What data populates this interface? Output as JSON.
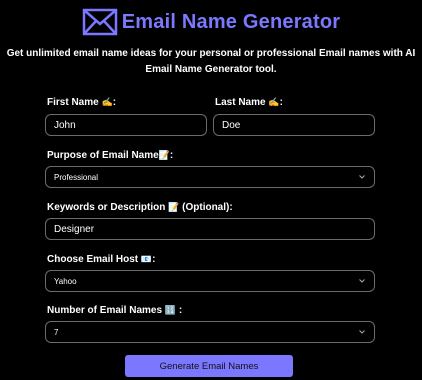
{
  "header": {
    "title": "Email Name Generator",
    "subtitle": "Get unlimited email name ideas for your personal or professional Email names with AI Email Name Generator tool."
  },
  "form": {
    "first_name": {
      "label": "First Name",
      "emoji": "✍️",
      "suffix": ":",
      "value": "John"
    },
    "last_name": {
      "label": "Last Name",
      "emoji": "✍️",
      "suffix": ":",
      "value": "Doe"
    },
    "purpose": {
      "label": "Purpose of Email Name",
      "emoji": "📝",
      "suffix": ":",
      "value": "Professional"
    },
    "keywords": {
      "label": "Keywords or Description",
      "emoji": "📝",
      "suffix": "(Optional):",
      "value": "Designer"
    },
    "host": {
      "label": "Choose Email Host",
      "emoji": "📧",
      "suffix": ":",
      "value": "Yahoo"
    },
    "count": {
      "label": "Number of Email Names",
      "emoji": "🔢",
      "suffix": ":",
      "value": "7"
    }
  },
  "actions": {
    "generate_label": "Generate Email Names"
  },
  "colors": {
    "accent": "#7b78ff",
    "background": "#000000",
    "border": "#6b6b6b"
  },
  "icons": {
    "logo": "envelope-icon",
    "dropdown": "chevron-down-icon"
  }
}
